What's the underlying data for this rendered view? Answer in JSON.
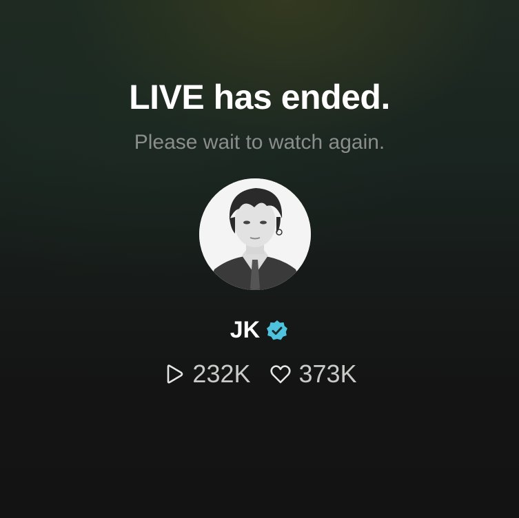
{
  "live_status": {
    "title": "LIVE has ended.",
    "subtitle": "Please wait to watch again."
  },
  "artist": {
    "name": "JK",
    "verified": true,
    "badge_color": "#4fc3dd"
  },
  "stats": {
    "plays": "232K",
    "likes": "373K",
    "plays_icon": "play-icon",
    "likes_icon": "heart-icon"
  }
}
